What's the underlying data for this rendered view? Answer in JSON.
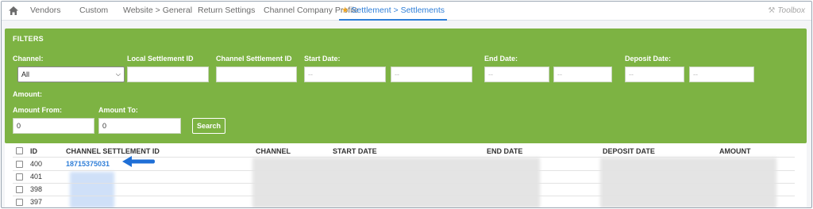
{
  "nav": {
    "tabs": [
      {
        "label": "Vendors"
      },
      {
        "label": "Custom"
      },
      {
        "label": "Website > General"
      },
      {
        "label": "Return Settings"
      },
      {
        "label": "Channel Company Profile"
      },
      {
        "label": "Settlement > Settlements"
      }
    ],
    "active_tab": "Settlement > Settlements",
    "toolbox_label": "Toolbox"
  },
  "filters": {
    "title": "FILTERS",
    "channel_label": "Channel:",
    "channel_value": "All",
    "local_settlement_id_label": "Local Settlement ID",
    "local_settlement_id_value": "",
    "channel_settlement_id_label": "Channel Settlement ID",
    "channel_settlement_id_value": "",
    "start_date_label": "Start Date:",
    "start_date_from_placeholder": "--",
    "start_date_to_placeholder": "--",
    "end_date_label": "End Date:",
    "end_date_from_placeholder": "--",
    "end_date_to_placeholder": "--",
    "deposit_date_label": "Deposit Date:",
    "deposit_date_from_placeholder": "--",
    "deposit_date_to_placeholder": "--",
    "amount_label": "Amount:",
    "amount_from_label": "Amount From:",
    "amount_from_value": "0",
    "amount_to_label": "Amount To:",
    "amount_to_value": "0",
    "search_label": "Search"
  },
  "grid": {
    "columns": [
      "ID",
      "CHANNEL SETTLEMENT ID",
      "CHANNEL",
      "START DATE",
      "END DATE",
      "DEPOSIT DATE",
      "AMOUNT"
    ],
    "rows": [
      {
        "id": "400",
        "channel_settlement_id": "18715375031"
      },
      {
        "id": "401",
        "channel_settlement_id": ""
      },
      {
        "id": "398",
        "channel_settlement_id": ""
      },
      {
        "id": "397",
        "channel_settlement_id": ""
      }
    ]
  },
  "colors": {
    "filter_panel": "#7db343",
    "active_tab": "#2f7fd8",
    "link": "#2f7fd8",
    "arrow": "#1f6fd6",
    "star": "#f2a61d"
  },
  "icons": {
    "home": "home-icon",
    "star": "star-icon",
    "toolbox": "toolbox-icon",
    "dropdown": "chevron-down-icon",
    "annotation": "arrow-left-icon"
  }
}
